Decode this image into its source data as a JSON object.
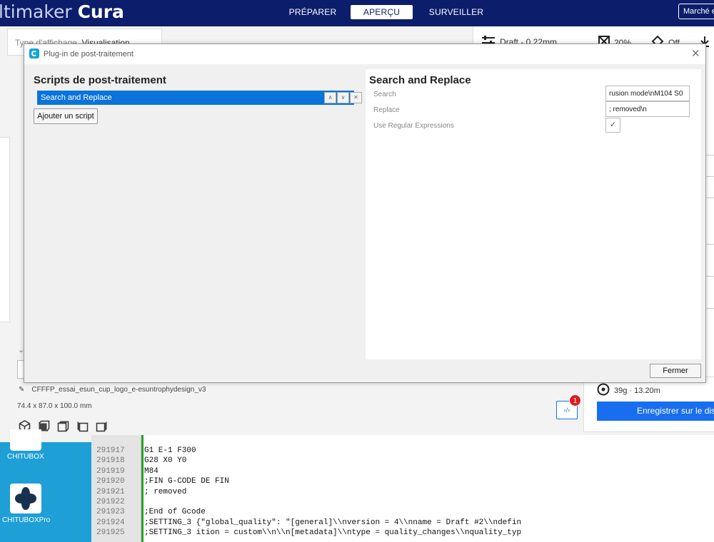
{
  "app": {
    "logo_light": "ltimaker ",
    "logo_bold": "Cura",
    "tabs": [
      "PRÉPARER",
      "APERÇU",
      "SURVEILLER"
    ],
    "active_tab": "APERÇU",
    "marketplace": "Marché e"
  },
  "view": {
    "label": "Type d'affichage",
    "value": "Visualisation..."
  },
  "settings_bar": {
    "profile": "Draft - 0.22mm",
    "infill": "20%",
    "support": "Off"
  },
  "dialog": {
    "title": "Plug-in de post-traitement",
    "scripts_heading": "Scripts de post-traitement",
    "scripts": [
      {
        "name": "Search and Replace"
      }
    ],
    "add_script": "Ajouter un script",
    "panel_title": "Search and Replace",
    "fields": {
      "search_label": "Search",
      "search_value": "rusion mode\\nM104 S0",
      "replace_label": "Replace",
      "replace_value": "; removed\\n",
      "regex_label": "Use Regular Expressions",
      "regex_checked": "✓"
    },
    "close": "Fermer"
  },
  "object": {
    "name": "CFFFP_essai_esun_cup_logo_e-esuntrophydesign_v3",
    "dims": "74.4 x 87.0 x 100.0 mm"
  },
  "print": {
    "info": "39g · 13.20m",
    "save": "Enregistrer sur le dis"
  },
  "gcode_badge": "1",
  "gcode_btn": "‹/›",
  "chitubox": {
    "apps": [
      {
        "label": "CHITUBOX"
      },
      {
        "label": "CHITUBOXPro"
      }
    ]
  },
  "editor_lines": [
    {
      "no": "291917",
      "code": "G1 E-1 F300"
    },
    {
      "no": "291918",
      "code": "G28 X0 Y0"
    },
    {
      "no": "291919",
      "code": "M84"
    },
    {
      "no": "291920",
      "code": ";FIN G-CODE DE FIN"
    },
    {
      "no": "291921",
      "code": "; removed"
    },
    {
      "no": "291922",
      "code": ""
    },
    {
      "no": "291923",
      "code": ";End of Gcode"
    },
    {
      "no": "291924",
      "code": ";SETTING_3 {\"global_quality\": \"[general]\\\\nversion = 4\\\\nname = Draft #2\\\\ndefin"
    },
    {
      "no": "291925",
      "code": ";SETTING_3 ition = custom\\\\n\\\\n[metadata]\\\\ntype = quality_changes\\\\nquality_typ"
    }
  ],
  "colors": {
    "header": "#0b1d6b",
    "accent": "#196ef0",
    "selection": "#0a74da",
    "chitubox": "#1e9fd6"
  }
}
